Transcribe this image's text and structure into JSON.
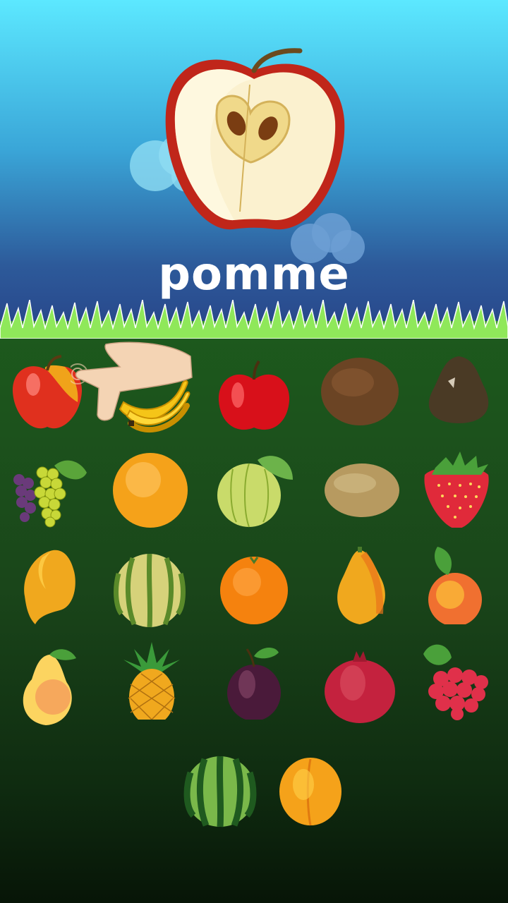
{
  "word": "pomme",
  "hero_icon": "apple-half-icon",
  "hint_icon": "pointing-hand-icon",
  "fruits": [
    {
      "name": "apple-icon"
    },
    {
      "name": "banana-icon"
    },
    {
      "name": "red-apple-icon"
    },
    {
      "name": "coconut-icon"
    },
    {
      "name": "fig-icon"
    },
    {
      "name": "grapes-icon"
    },
    {
      "name": "grapefruit-icon"
    },
    {
      "name": "guava-icon"
    },
    {
      "name": "kiwi-icon"
    },
    {
      "name": "strawberry-icon"
    },
    {
      "name": "mango-icon"
    },
    {
      "name": "melon-icon"
    },
    {
      "name": "orange-icon"
    },
    {
      "name": "papaya-icon"
    },
    {
      "name": "peach-icon"
    },
    {
      "name": "pear-icon"
    },
    {
      "name": "pineapple-icon"
    },
    {
      "name": "plum-icon"
    },
    {
      "name": "pomegranate-icon"
    },
    {
      "name": "raspberry-icon"
    },
    {
      "name": "watermelon-icon"
    },
    {
      "name": "apricot-icon"
    }
  ],
  "colors": {
    "sky_top": "#5ce8ff",
    "sky_bottom": "#28468a",
    "field_top": "#1d5a1d",
    "field_bottom": "#071507",
    "grass": "#7fe04a"
  }
}
